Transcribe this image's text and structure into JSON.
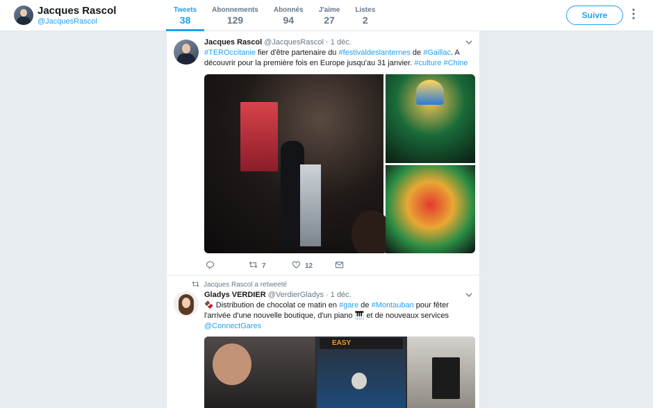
{
  "profile": {
    "name": "Jacques Rascol",
    "handle": "@JacquesRascol"
  },
  "nav": [
    {
      "label": "Tweets",
      "value": "38",
      "active": true
    },
    {
      "label": "Abonnements",
      "value": "129"
    },
    {
      "label": "Abonnés",
      "value": "94"
    },
    {
      "label": "J'aime",
      "value": "27"
    },
    {
      "label": "Listes",
      "value": "2"
    }
  ],
  "follow_label": "Suivre",
  "more_label": "⋮",
  "tweets": [
    {
      "name": "Jacques Rascol",
      "handle": "@JacquesRascol",
      "dot": "·",
      "time": "1 déc.",
      "text": {
        "tag1": "#TEROccitanie",
        "t1": " fier d'être partenaire du ",
        "tag2": "#festivaldeslanternes",
        "t2": " de ",
        "tag3": "#Gaillac",
        "t3": ". A découvrir pour la première fois en Europe jusqu'au 31 janvier. ",
        "tag4": "#culture",
        "t4": " ",
        "tag5": "#Chine"
      },
      "retweets": "7",
      "likes": "12"
    },
    {
      "retweeted_by": "Jacques Rascol a retweeté",
      "name": "Gladys VERDIER",
      "handle": "@VerdierGladys",
      "dot": "·",
      "time": "1 déc.",
      "text": {
        "t0": "🍫 Distribution de chocolat ce matin en ",
        "tag1": "#gare",
        "t1": " de ",
        "tag2": "#Montauban",
        "t2": " pour fêter l'arrivée d'une nouvelle boutique, d'un piano 🎹 et de nouveaux services ",
        "tag3": "@ConnectGares"
      },
      "media_sign": "EASY"
    }
  ],
  "icons": {
    "reply": "reply-icon",
    "retweet": "retweet-icon",
    "like": "heart-icon",
    "dm": "envelope-icon",
    "caret": "chevron-down-icon"
  },
  "colors": {
    "accent": "#1da1f2",
    "background": "#e6ecf0",
    "muted": "#657786"
  }
}
